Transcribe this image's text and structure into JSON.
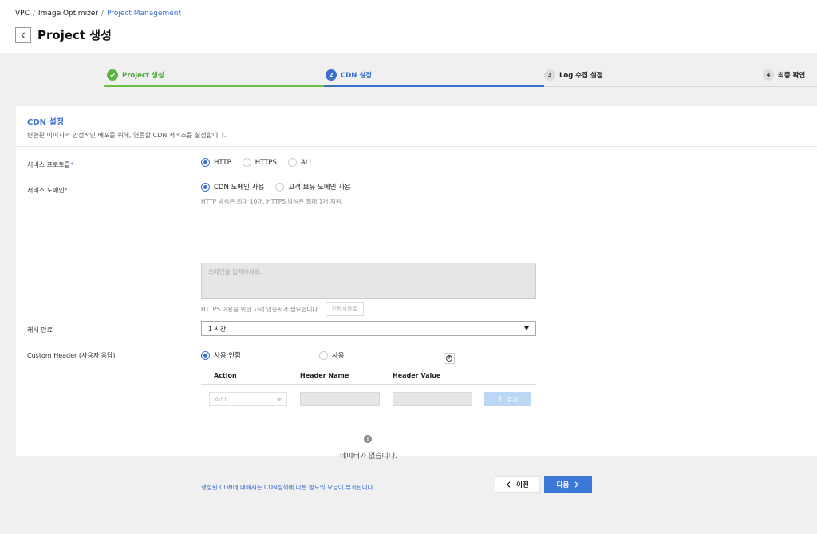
{
  "breadcrumb": {
    "items": [
      "VPC",
      "Image Optimizer",
      "Project Management"
    ]
  },
  "page": {
    "title": "Project 생성"
  },
  "stepper": {
    "steps": [
      {
        "num": "1",
        "label": "Project 생성",
        "state": "done"
      },
      {
        "num": "2",
        "label": "CDN 설정",
        "state": "active"
      },
      {
        "num": "3",
        "label": "Log 수집 설정",
        "state": "pending"
      },
      {
        "num": "4",
        "label": "최종 확인",
        "state": "pending"
      }
    ]
  },
  "card": {
    "title": "CDN 설정",
    "description": "변환된 이미지의 안정적인 배포를 위해, 연동할 CDN 서비스를 설정합니다."
  },
  "protocol": {
    "label": "서비스 프로토콜",
    "required_mark": "*",
    "options": [
      "HTTP",
      "HTTPS",
      "ALL"
    ],
    "selected": "HTTP"
  },
  "domain": {
    "label": "서비스 도메인",
    "required_mark": "*",
    "options": [
      "CDN 도메인 사용",
      "고객 보유 도메인 사용"
    ],
    "selected": "CDN 도메인 사용",
    "hint": "HTTP 방식은 최대 10개, HTTPS 방식은 최대 1개 지원.",
    "placeholder": "도메인을 입력하세요.",
    "cert_hint": "HTTPS 이용을 위한 고객 인증서가 필요합니다.",
    "cert_button": "인증서등록"
  },
  "cache": {
    "label": "캐시 만료",
    "value": "1 시간"
  },
  "custom_header": {
    "label": "Custom Header (사용자 응답)",
    "options": [
      "사용 안함",
      "사용"
    ],
    "selected": "사용 안함",
    "columns": [
      "Action",
      "Header Name",
      "Header Value"
    ],
    "action_placeholder": "Add",
    "add_button": "추가",
    "empty_icon": "!",
    "empty_text": "데이터가 없습니다."
  },
  "note": "생성된 CDN에 대해서는 CDN정책에 따른 별도의 요금이 부과됩니다.",
  "footer": {
    "prev_label": "이전",
    "next_label": "다음"
  },
  "colors": {
    "accent": "#3b6fd1",
    "done": "#5bb641",
    "add_button": "#bcd7f5"
  }
}
